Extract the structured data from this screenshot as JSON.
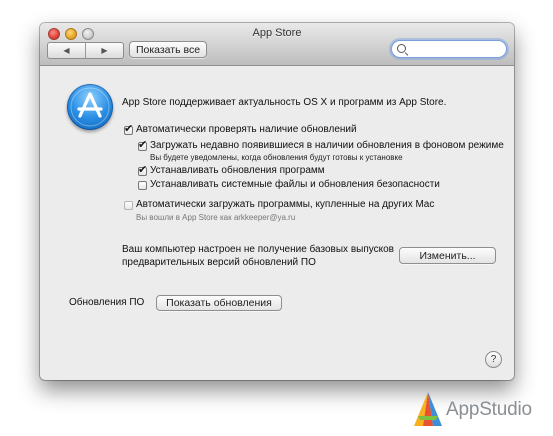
{
  "window": {
    "title": "App Store"
  },
  "toolbar": {
    "back_glyph": "◀",
    "forward_glyph": "▶",
    "show_all_label": "Показать все",
    "search_placeholder": ""
  },
  "header": {
    "text": "App Store поддерживает актуальность OS X и программ из App Store."
  },
  "options": {
    "auto_check": {
      "label": "Автоматически проверять наличие обновлений",
      "checked": true
    },
    "download_bg": {
      "label": "Загружать недавно появившиеся в наличии обновления в фоновом режиме",
      "sublabel": "Вы будете уведомлены, когда обновления будут готовы к установке",
      "checked": true
    },
    "install_apps": {
      "label": "Устанавливать обновления программ",
      "checked": true
    },
    "install_system": {
      "label": "Устанавливать системные файлы и обновления безопасности",
      "checked": false
    },
    "auto_download": {
      "label": "Автоматически загружать программы, купленные на других Mac",
      "sublabel": "Вы вошли в App Store как arkkeeper@ya.ru",
      "checked": false
    }
  },
  "prerelease": {
    "line1": "Ваш компьютер настроен не получение базовых выпусков",
    "line2": "предварительных версий обновлений ПО",
    "button_label": "Изменить..."
  },
  "updates": {
    "label": "Обновления ПО",
    "button_label": "Показать обновления"
  },
  "help": {
    "glyph": "?"
  },
  "watermark": {
    "text": "AppStudio"
  },
  "colors": {
    "accent": "#2a8fe4",
    "window_bg": "#ececec",
    "focus_ring": "#7aa0d8"
  }
}
